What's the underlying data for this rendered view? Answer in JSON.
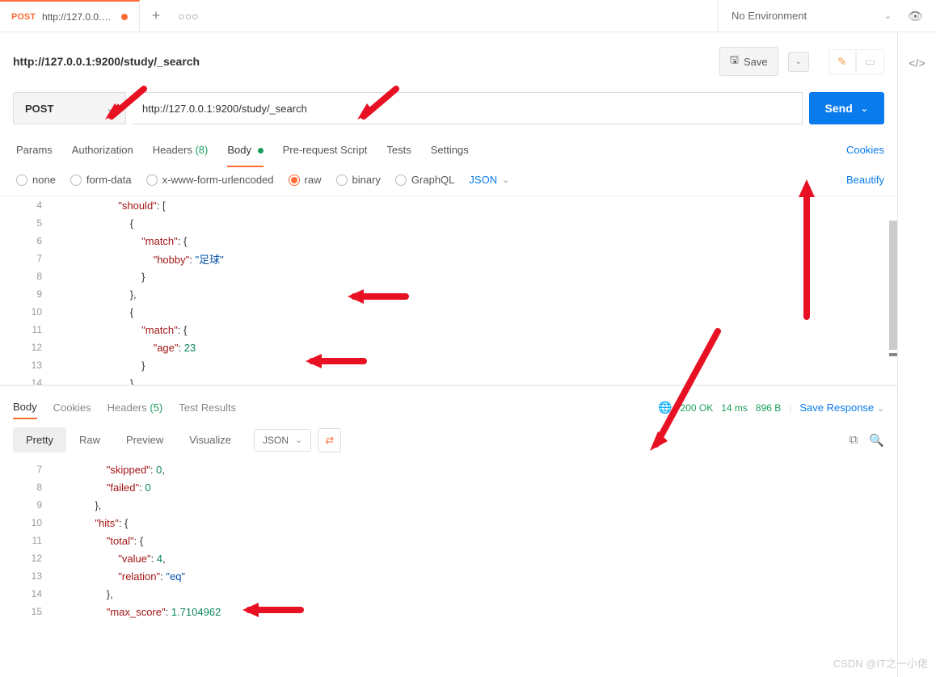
{
  "tab": {
    "method": "POST",
    "title": "http://127.0.0.1:9..."
  },
  "environment": "No Environment",
  "url_display": "http://127.0.0.1:9200/study/_search",
  "save_label": "Save",
  "method": "POST",
  "url_input": "http://127.0.0.1:9200/study/_search",
  "send_label": "Send",
  "req_tabs": {
    "params": "Params",
    "auth": "Authorization",
    "headers": "Headers",
    "headers_count": "(8)",
    "body": "Body",
    "prerequest": "Pre-request Script",
    "tests": "Tests",
    "settings": "Settings"
  },
  "cookies_link": "Cookies",
  "body_types": {
    "none": "none",
    "formdata": "form-data",
    "urlencoded": "x-www-form-urlencoded",
    "raw": "raw",
    "binary": "binary",
    "graphql": "GraphQL"
  },
  "json_label": "JSON",
  "beautify_label": "Beautify",
  "request_body_lines": [
    {
      "n": 4,
      "indent": 5,
      "tokens": [
        [
          "key",
          "\"should\""
        ],
        [
          "punc",
          ": "
        ],
        [
          "punc",
          "["
        ]
      ]
    },
    {
      "n": 5,
      "indent": 6,
      "tokens": [
        [
          "punc",
          "{"
        ]
      ]
    },
    {
      "n": 6,
      "indent": 7,
      "tokens": [
        [
          "key",
          "\"match\""
        ],
        [
          "punc",
          ": {"
        ]
      ]
    },
    {
      "n": 7,
      "indent": 8,
      "tokens": [
        [
          "key",
          "\"hobby\""
        ],
        [
          "punc",
          ": "
        ],
        [
          "str",
          "\"足球\""
        ]
      ]
    },
    {
      "n": 8,
      "indent": 7,
      "tokens": [
        [
          "punc",
          "}"
        ]
      ]
    },
    {
      "n": 9,
      "indent": 6,
      "tokens": [
        [
          "punc",
          "},"
        ]
      ]
    },
    {
      "n": 10,
      "indent": 6,
      "tokens": [
        [
          "punc",
          "{"
        ]
      ]
    },
    {
      "n": 11,
      "indent": 7,
      "tokens": [
        [
          "key",
          "\"match\""
        ],
        [
          "punc",
          ": {"
        ]
      ]
    },
    {
      "n": 12,
      "indent": 8,
      "tokens": [
        [
          "key",
          "\"age\""
        ],
        [
          "punc",
          ": "
        ],
        [
          "num",
          "23"
        ]
      ]
    },
    {
      "n": 13,
      "indent": 7,
      "tokens": [
        [
          "punc",
          "}"
        ]
      ]
    },
    {
      "n": 14,
      "indent": 6,
      "tokens": [
        [
          "punc",
          "}"
        ]
      ]
    }
  ],
  "resp_tabs": {
    "body": "Body",
    "cookies": "Cookies",
    "headers": "Headers",
    "headers_count": "(5)",
    "test_results": "Test Results"
  },
  "status": {
    "code": "200 OK",
    "time": "14 ms",
    "size": "896 B"
  },
  "save_response": "Save Response",
  "view_modes": {
    "pretty": "Pretty",
    "raw": "Raw",
    "preview": "Preview",
    "visualize": "Visualize"
  },
  "response_body_lines": [
    {
      "n": 7,
      "indent": 4,
      "tokens": [
        [
          "key",
          "\"skipped\""
        ],
        [
          "punc",
          ": "
        ],
        [
          "num",
          "0"
        ],
        [
          "punc",
          ","
        ]
      ]
    },
    {
      "n": 8,
      "indent": 4,
      "tokens": [
        [
          "key",
          "\"failed\""
        ],
        [
          "punc",
          ": "
        ],
        [
          "num",
          "0"
        ]
      ]
    },
    {
      "n": 9,
      "indent": 3,
      "tokens": [
        [
          "punc",
          "},"
        ]
      ]
    },
    {
      "n": 10,
      "indent": 3,
      "tokens": [
        [
          "key",
          "\"hits\""
        ],
        [
          "punc",
          ": {"
        ]
      ]
    },
    {
      "n": 11,
      "indent": 4,
      "tokens": [
        [
          "key",
          "\"total\""
        ],
        [
          "punc",
          ": {"
        ]
      ]
    },
    {
      "n": 12,
      "indent": 5,
      "tokens": [
        [
          "key",
          "\"value\""
        ],
        [
          "punc",
          ": "
        ],
        [
          "num",
          "4"
        ],
        [
          "punc",
          ","
        ]
      ]
    },
    {
      "n": 13,
      "indent": 5,
      "tokens": [
        [
          "key",
          "\"relation\""
        ],
        [
          "punc",
          ": "
        ],
        [
          "str",
          "\"eq\""
        ]
      ]
    },
    {
      "n": 14,
      "indent": 4,
      "tokens": [
        [
          "punc",
          "},"
        ]
      ]
    },
    {
      "n": 15,
      "indent": 4,
      "tokens": [
        [
          "key",
          "\"max_score\""
        ],
        [
          "punc",
          ": "
        ],
        [
          "num",
          "1.7104962"
        ]
      ]
    }
  ],
  "watermark": "CSDN @IT之一小佬"
}
